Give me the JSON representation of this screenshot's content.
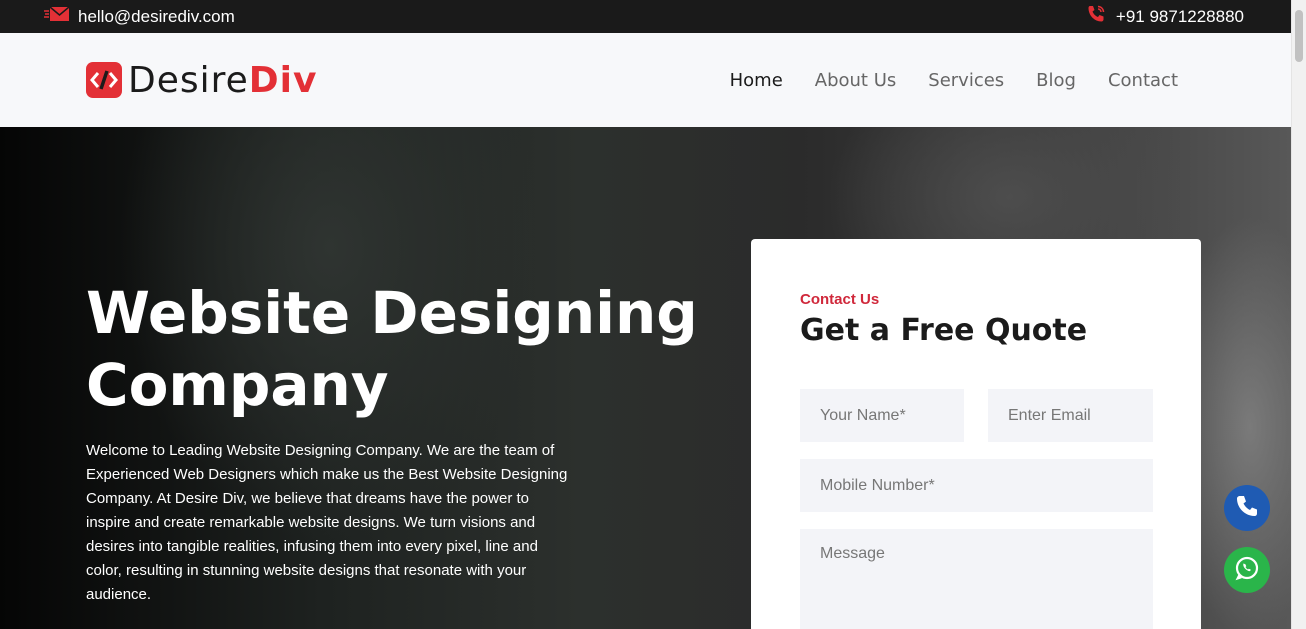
{
  "topbar": {
    "email": "hello@desirediv.com",
    "phone": "+91 9871228880",
    "email_icon": "envelope-icon",
    "phone_icon": "phone-icon"
  },
  "brand": {
    "name_part1": "Desire",
    "name_part2": "Div",
    "accent_color": "#e33036"
  },
  "nav": {
    "items": [
      {
        "label": "Home"
      },
      {
        "label": "About Us"
      },
      {
        "label": "Services"
      },
      {
        "label": "Blog"
      },
      {
        "label": "Contact"
      }
    ]
  },
  "hero": {
    "title": "Website Designing Company",
    "description": "Welcome to Leading Website Designing Company. We are the team of Experienced Web Designers which make us the Best Website Designing Company. At Desire Div, we believe that dreams have the power to inspire and create remarkable website designs. We turn visions and desires into tangible realities, infusing them into every pixel, line and color, resulting in stunning website designs that resonate with your audience."
  },
  "form": {
    "eyebrow": "Contact Us",
    "title": "Get a Free Quote",
    "name_placeholder": "Your Name*",
    "email_placeholder": "Enter Email",
    "mobile_placeholder": "Mobile Number*",
    "message_placeholder": "Message"
  },
  "floating": {
    "call_icon": "phone-icon",
    "whatsapp_icon": "whatsapp-icon",
    "call_color": "#1f5bb3",
    "whatsapp_color": "#2ab54a"
  }
}
